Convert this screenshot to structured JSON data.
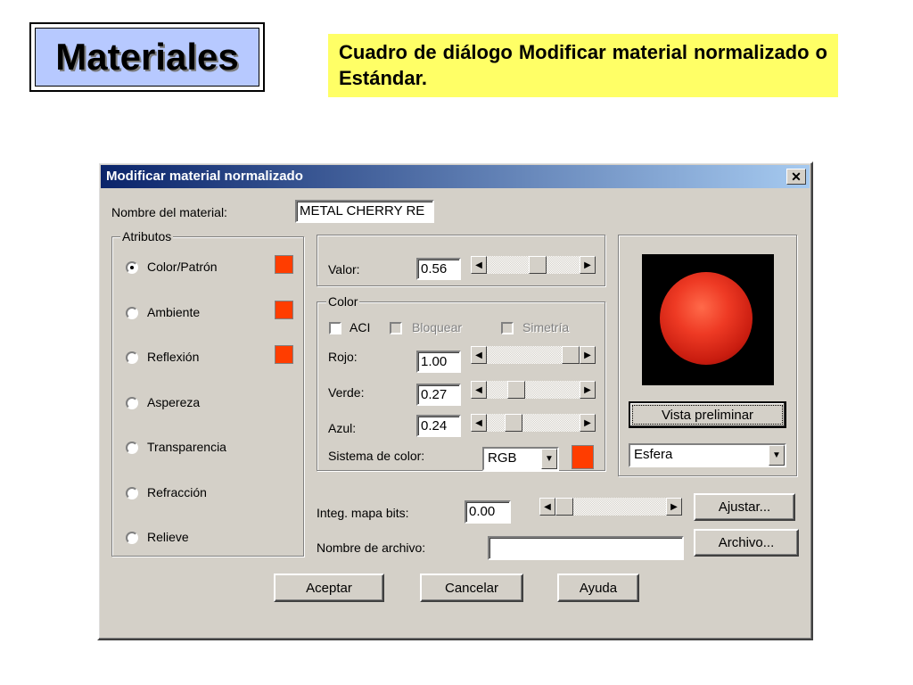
{
  "slide": {
    "title": "Materiales",
    "caption": "Cuadro de diálogo Modificar material normalizado o Estándar."
  },
  "dialog": {
    "title": "Modificar material normalizado",
    "close_glyph": "✕",
    "material_name_label": "Nombre del material:",
    "material_name_value": "METAL CHERRY RE",
    "attributes_group_label": "Atributos",
    "attributes": [
      {
        "label": "Color/Patrón",
        "selected": true,
        "has_swatch": true
      },
      {
        "label": "Ambiente",
        "selected": false,
        "has_swatch": true
      },
      {
        "label": "Reflexión",
        "selected": false,
        "has_swatch": true
      },
      {
        "label": "Aspereza",
        "selected": false,
        "has_swatch": false
      },
      {
        "label": "Transparencia",
        "selected": false,
        "has_swatch": false
      },
      {
        "label": "Refracción",
        "selected": false,
        "has_swatch": false
      },
      {
        "label": "Relieve",
        "selected": false,
        "has_swatch": false
      }
    ],
    "value_label": "Valor:",
    "value": "0.56",
    "color_group_label": "Color",
    "aci_label": "ACI",
    "lock_label": "Bloquear",
    "symmetry_label": "Simetría",
    "red_label": "Rojo:",
    "red_value": "1.00",
    "green_label": "Verde:",
    "green_value": "0.27",
    "blue_label": "Azul:",
    "blue_value": "0.24",
    "color_system_label": "Sistema de color:",
    "color_system_value": "RGB",
    "bitmap_blend_label": "Integ. mapa bits:",
    "bitmap_blend_value": "0.00",
    "file_name_label": "Nombre de archivo:",
    "file_name_value": "",
    "adjust_button": "Ajustar...",
    "file_button": "Archivo...",
    "preview_button": "Vista preliminar",
    "preview_shape": "Esfera",
    "ok_button": "Aceptar",
    "cancel_button": "Cancelar",
    "help_button": "Ayuda",
    "swatch_color": "#ff3d00",
    "slider_levels": {
      "value": 0.56,
      "red": 1.0,
      "green": 0.27,
      "blue": 0.24,
      "bitmap_blend": 0.0
    }
  }
}
